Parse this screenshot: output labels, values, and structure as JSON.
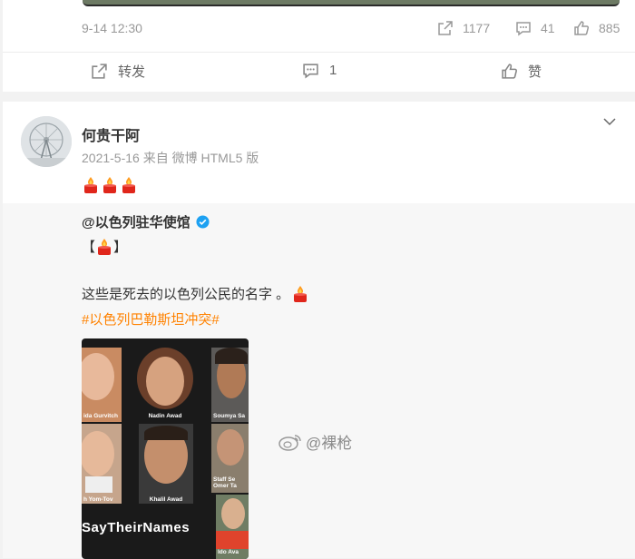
{
  "post1": {
    "time": "9-14 12:30",
    "stats": {
      "forwards": "1177",
      "comments": "41",
      "likes": "885"
    },
    "actions": {
      "repost_label": "转发",
      "comment_count": "1",
      "like_label": "赞"
    }
  },
  "post2": {
    "username": "何贵干阿",
    "posted_meta": "2021-5-16 来自 微博 HTML5 版",
    "repost": {
      "author": "@以色列驻华使馆",
      "bracket_open": "【",
      "bracket_close": "】",
      "text": "这些是死去的以色列公民的名字 。",
      "hashtag": "#以色列巴勒斯坦冲突#",
      "image": {
        "names": [
          "ida Gurvitch",
          "Nadin Awad",
          "Soumya Sa",
          "h Yom-Tov",
          "Khalil Awad",
          "Staff Se Omer Ta",
          "Ido Ava"
        ],
        "caption": "SayTheirNames"
      }
    }
  },
  "watermark": "@裸枪",
  "colors": {
    "hashtag": "#ff8200",
    "verified": "#1da1f2",
    "muted": "#999999"
  }
}
